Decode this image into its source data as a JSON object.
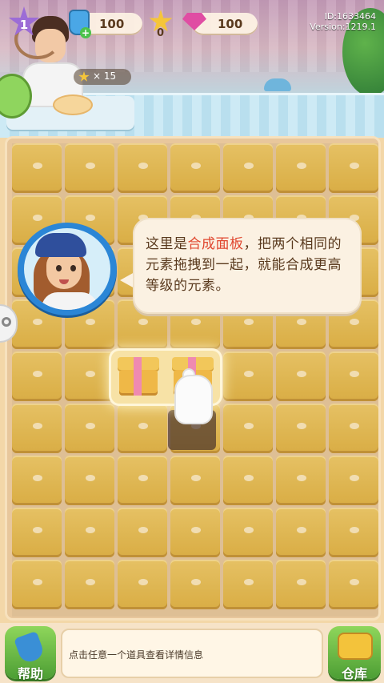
{
  "hud": {
    "level": "1",
    "energy": "100",
    "stars": "0",
    "gems": "100",
    "id_text": "ID:1633464",
    "version_text": "Version:1219.1",
    "goal_text": "× 15"
  },
  "tutorial": {
    "text_before": "这里是",
    "text_highlight": "合成面板",
    "text_after": "，把两个相同的元素拖拽到一起，就能合成更高等级的元素。"
  },
  "bottom": {
    "help_label": "帮助",
    "info_text": "点击任意一个道具查看详情信息",
    "store_label": "仓库"
  },
  "colors": {
    "highlight_text": "#e0472f",
    "board_tile": "#e2b548",
    "button_green": "#4c9e34"
  },
  "icons": [
    "level-star-icon",
    "energy-icon",
    "plus-icon",
    "star-icon",
    "gem-icon",
    "goal-star-icon",
    "gear-icon",
    "shovel-icon",
    "chest-icon",
    "hand-icon"
  ]
}
